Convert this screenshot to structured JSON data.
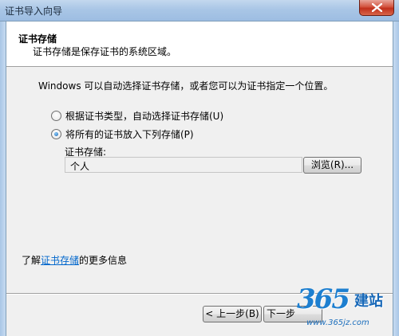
{
  "window": {
    "title": "证书导入向导"
  },
  "header": {
    "title": "证书存储",
    "subtitle": "证书存储是保存证书的系统区域。"
  },
  "body": {
    "intro": "Windows 可以自动选择证书存储，或者您可以为证书指定一个位置。",
    "radio_auto": "根据证书类型，自动选择证书存储(U)",
    "radio_manual": "将所有的证书放入下列存储(P)",
    "store_label": "证书存储:",
    "store_value": "个人",
    "browse_label": "浏览(R)...",
    "selected_option": "manual"
  },
  "footer": {
    "info_prefix": "了解",
    "info_link": "证书存储",
    "info_suffix": "的更多信息",
    "back_label": "< 上一步(B)",
    "next_label": "下一步"
  },
  "watermark": {
    "logo_number": "365",
    "logo_text": "建站",
    "url": "www.365jz.com"
  },
  "colors": {
    "link": "#0066cc",
    "watermark": "#1d7fd0"
  }
}
